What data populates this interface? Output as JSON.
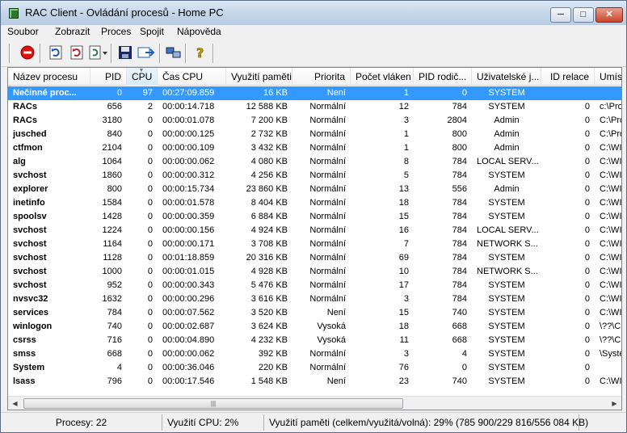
{
  "window": {
    "title": "RAC Client - Ovládání procesů - Home PC"
  },
  "menubar": {
    "items": [
      "Soubor",
      "Zobrazit",
      "Proces",
      "Spojit",
      "Nápověda"
    ]
  },
  "toolbar": {
    "buttons": [
      {
        "name": "stop-process-icon",
        "color": "#dd1111"
      },
      {
        "name": "refresh-icon",
        "color": "#1b4fbf"
      },
      {
        "name": "refresh-red-icon",
        "color": "#c0202a"
      },
      {
        "name": "auto-refresh-dropdown-icon",
        "color": "#1b7f3f"
      },
      {
        "name": "save-icon",
        "color": "#1a2a60"
      },
      {
        "name": "export-icon",
        "color": "#2060b0"
      },
      {
        "name": "connect-icon",
        "color": "#3a76c8"
      },
      {
        "name": "help-icon",
        "color": "#d0a000"
      }
    ]
  },
  "list": {
    "columns": [
      "Název procesu",
      "PID",
      "CPU",
      "Čas CPU",
      "Využití paměti",
      "Priorita",
      "Počet vláken",
      "PID rodič...",
      "Uživatelské j...",
      "ID relace",
      "Umístě"
    ],
    "sorted_column": "CPU",
    "selected_index": 0,
    "rows": [
      [
        "Nečinné proc...",
        "0",
        "97",
        "00:27:09.859",
        "16 KB",
        "Není",
        "1",
        "0",
        "SYSTEM",
        "",
        ""
      ],
      [
        "RACs",
        "656",
        "2",
        "00:00:14.718",
        "12 588 KB",
        "Normální",
        "12",
        "784",
        "SYSTEM",
        "0",
        "c:\\Prog"
      ],
      [
        "RACs",
        "3180",
        "0",
        "00:00:01.078",
        "7 200 KB",
        "Normální",
        "3",
        "2804",
        "Admin",
        "0",
        "C:\\Prog"
      ],
      [
        "jusched",
        "840",
        "0",
        "00:00:00.125",
        "2 732 KB",
        "Normální",
        "1",
        "800",
        "Admin",
        "0",
        "C:\\Prog"
      ],
      [
        "ctfmon",
        "2104",
        "0",
        "00:00:00.109",
        "3 432 KB",
        "Normální",
        "1",
        "800",
        "Admin",
        "0",
        "C:\\WIN"
      ],
      [
        "alg",
        "1064",
        "0",
        "00:00:00.062",
        "4 080 KB",
        "Normální",
        "8",
        "784",
        "LOCAL SERV...",
        "0",
        "C:\\WIN"
      ],
      [
        "svchost",
        "1860",
        "0",
        "00:00:00.312",
        "4 256 KB",
        "Normální",
        "5",
        "784",
        "SYSTEM",
        "0",
        "C:\\WIN"
      ],
      [
        "explorer",
        "800",
        "0",
        "00:00:15.734",
        "23 860 KB",
        "Normální",
        "13",
        "556",
        "Admin",
        "0",
        "C:\\WIN"
      ],
      [
        "inetinfo",
        "1584",
        "0",
        "00:00:01.578",
        "8 404 KB",
        "Normální",
        "18",
        "784",
        "SYSTEM",
        "0",
        "C:\\WIN"
      ],
      [
        "spoolsv",
        "1428",
        "0",
        "00:00:00.359",
        "6 884 KB",
        "Normální",
        "15",
        "784",
        "SYSTEM",
        "0",
        "C:\\WIN"
      ],
      [
        "svchost",
        "1224",
        "0",
        "00:00:00.156",
        "4 924 KB",
        "Normální",
        "16",
        "784",
        "LOCAL SERV...",
        "0",
        "C:\\WIN"
      ],
      [
        "svchost",
        "1164",
        "0",
        "00:00:00.171",
        "3 708 KB",
        "Normální",
        "7",
        "784",
        "NETWORK S...",
        "0",
        "C:\\WIN"
      ],
      [
        "svchost",
        "1128",
        "0",
        "00:01:18.859",
        "20 316 KB",
        "Normální",
        "69",
        "784",
        "SYSTEM",
        "0",
        "C:\\WIN"
      ],
      [
        "svchost",
        "1000",
        "0",
        "00:00:01.015",
        "4 928 KB",
        "Normální",
        "10",
        "784",
        "NETWORK S...",
        "0",
        "C:\\WIN"
      ],
      [
        "svchost",
        "952",
        "0",
        "00:00:00.343",
        "5 476 KB",
        "Normální",
        "17",
        "784",
        "SYSTEM",
        "0",
        "C:\\WIN"
      ],
      [
        "nvsvc32",
        "1632",
        "0",
        "00:00:00.296",
        "3 616 KB",
        "Normální",
        "3",
        "784",
        "SYSTEM",
        "0",
        "C:\\WIN"
      ],
      [
        "services",
        "784",
        "0",
        "00:00:07.562",
        "3 520 KB",
        "Není",
        "15",
        "740",
        "SYSTEM",
        "0",
        "C:\\WIN"
      ],
      [
        "winlogon",
        "740",
        "0",
        "00:00:02.687",
        "3 624 KB",
        "Vysoká",
        "18",
        "668",
        "SYSTEM",
        "0",
        "\\??\\C:\\"
      ],
      [
        "csrss",
        "716",
        "0",
        "00:00:04.890",
        "4 232 KB",
        "Vysoká",
        "11",
        "668",
        "SYSTEM",
        "0",
        "\\??\\C:\\"
      ],
      [
        "smss",
        "668",
        "0",
        "00:00:00.062",
        "392 KB",
        "Normální",
        "3",
        "4",
        "SYSTEM",
        "0",
        "\\System"
      ],
      [
        "System",
        "4",
        "0",
        "00:00:36.046",
        "220 KB",
        "Normální",
        "76",
        "0",
        "SYSTEM",
        "0",
        ""
      ],
      [
        "lsass",
        "796",
        "0",
        "00:00:17.546",
        "1 548 KB",
        "Není",
        "23",
        "740",
        "SYSTEM",
        "0",
        "C:\\WIN"
      ]
    ]
  },
  "status": {
    "processes": "Procesy: 22",
    "cpu": "Využití CPU: 2%",
    "memory": "Využití paměti (celkem/využitá/volná): 29% (785 900/229 816/556 084 KB)"
  },
  "colors": {
    "selection": "#3399ff",
    "titlebar": "#c6d6ea"
  }
}
